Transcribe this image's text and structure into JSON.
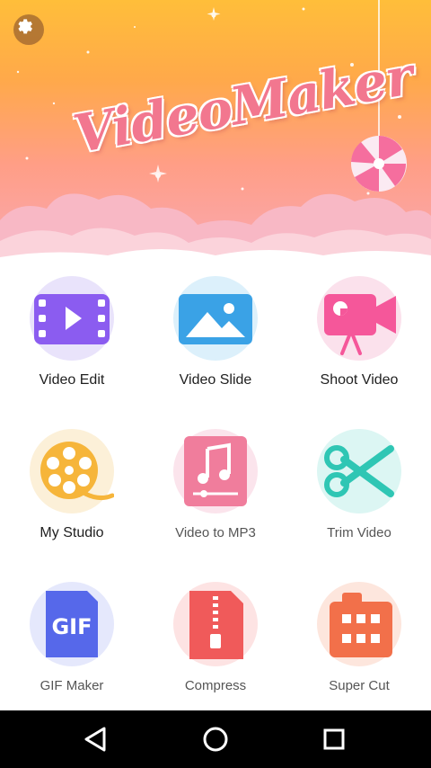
{
  "header": {
    "title": "VideoMaker"
  },
  "icons": {
    "settings": "gear-icon",
    "lollipop": "lollipop-icon"
  },
  "tiles": [
    {
      "label": "Video Edit",
      "icon": "film-play-icon"
    },
    {
      "label": "Video Slide",
      "icon": "picture-icon"
    },
    {
      "label": "Shoot Video",
      "icon": "camera-icon"
    },
    {
      "label": "My Studio",
      "icon": "film-reel-icon"
    },
    {
      "label": "Video to MP3",
      "icon": "music-note-icon"
    },
    {
      "label": "Trim Video",
      "icon": "scissors-icon"
    },
    {
      "label": "GIF Maker",
      "icon": "gif-icon",
      "badge": "GIF"
    },
    {
      "label": "Compress",
      "icon": "zip-icon"
    },
    {
      "label": "Super Cut",
      "icon": "super-cut-icon"
    }
  ],
  "navbar": {
    "back": "back-triangle-icon",
    "home": "home-circle-icon",
    "recents": "recents-square-icon"
  },
  "colors": {
    "banner_top": "#ffbe3a",
    "banner_bottom": "#f9a9b4",
    "title_pink": "#f2778f"
  }
}
